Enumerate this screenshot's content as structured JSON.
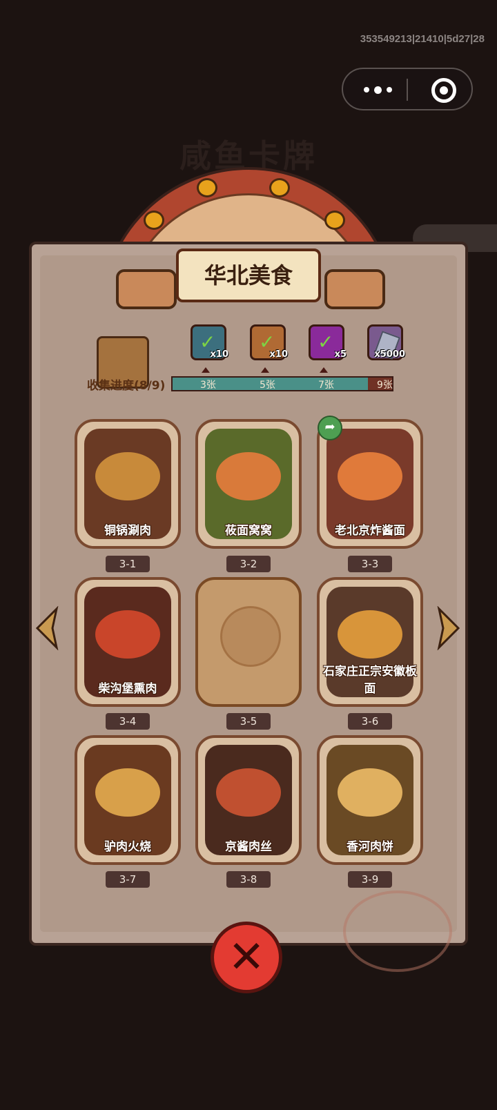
{
  "debug_id": "353549213|21410|5d27|28",
  "header": {
    "background_title": "咸鱼卡牌"
  },
  "panel": {
    "title": "华北美食"
  },
  "progress": {
    "label": "收集进度(8/9)",
    "collected": 8,
    "total": 9,
    "milestones": [
      {
        "label": "3张",
        "reward_qty": "x10",
        "reward_icon": "chest-icon",
        "claimed": true
      },
      {
        "label": "5张",
        "reward_qty": "x10",
        "reward_icon": "scroll-icon",
        "claimed": true
      },
      {
        "label": "7张",
        "reward_qty": "x5",
        "reward_icon": "orb-icon",
        "claimed": true
      },
      {
        "label": "9张",
        "reward_qty": "x5000",
        "reward_icon": "gem-icon",
        "claimed": false
      }
    ]
  },
  "cards": [
    {
      "id": "3-1",
      "name": "铜锅涮肉",
      "unlocked": true
    },
    {
      "id": "3-2",
      "name": "莜面窝窝",
      "unlocked": true
    },
    {
      "id": "3-3",
      "name": "老北京炸酱面",
      "unlocked": true
    },
    {
      "id": "3-4",
      "name": "柴沟堡熏肉",
      "unlocked": true
    },
    {
      "id": "3-5",
      "name": "",
      "unlocked": false
    },
    {
      "id": "3-6",
      "name": "石家庄正宗安徽板面",
      "unlocked": true
    },
    {
      "id": "3-7",
      "name": "驴肉火烧",
      "unlocked": true
    },
    {
      "id": "3-8",
      "name": "京酱肉丝",
      "unlocked": true
    },
    {
      "id": "3-9",
      "name": "香河肉饼",
      "unlocked": true
    }
  ],
  "colors": {
    "accent": "#e33b32",
    "bar_fill": "#4a9088",
    "parchment": "#b8a295"
  }
}
